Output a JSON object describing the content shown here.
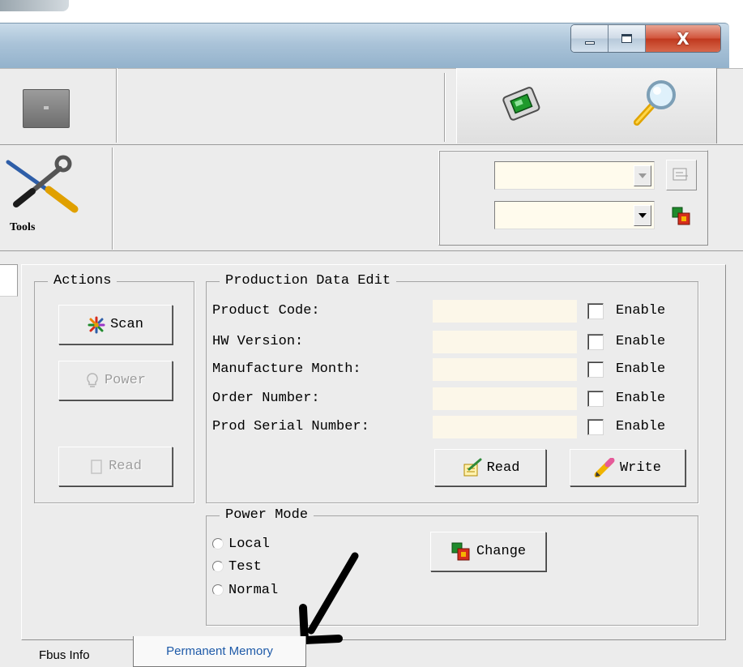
{
  "window": {
    "controls": {
      "minimize_icon": "minimize-icon",
      "maximize_icon": "maximize-icon",
      "close_glyph": "X"
    }
  },
  "toolbar": {
    "tools_label": "Tools"
  },
  "actions": {
    "title": "Actions",
    "scan_label": "Scan",
    "power_label": "Power",
    "read_label": "Read"
  },
  "production": {
    "title": "Production Data Edit",
    "fields": [
      {
        "label": "Product Code:",
        "value": "",
        "enable_label": "Enable"
      },
      {
        "label": "HW Version:",
        "value": "",
        "enable_label": "Enable"
      },
      {
        "label": "Manufacture Month:",
        "value": "",
        "enable_label": "Enable"
      },
      {
        "label": "Order Number:",
        "value": "",
        "enable_label": "Enable"
      },
      {
        "label": "Prod Serial Number:",
        "value": "",
        "enable_label": "Enable"
      }
    ],
    "read_label": "Read",
    "write_label": "Write"
  },
  "power_mode": {
    "title": "Power Mode",
    "options": [
      "Local",
      "Test",
      "Normal"
    ],
    "change_label": "Change"
  },
  "tabs": {
    "fbus_info": "Fbus Info",
    "permanent_memory": "Permanent Memory"
  },
  "colors": {
    "input_bg": "#fcf7e9",
    "tab_link": "#1e5aa8",
    "close_red": "#c0391f"
  }
}
